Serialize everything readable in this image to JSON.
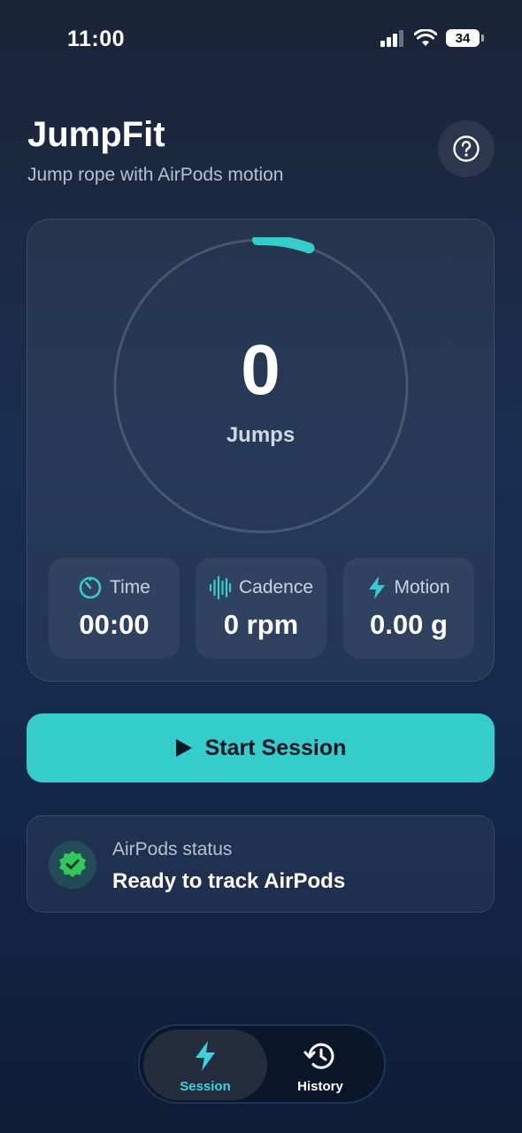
{
  "status_bar": {
    "time": "11:00",
    "battery": "34",
    "icons": [
      "cellular-signal-icon",
      "wifi-icon",
      "battery-icon"
    ]
  },
  "header": {
    "title": "JumpFit",
    "subtitle": "Jump rope with AirPods motion",
    "help_icon": "question-mark-icon"
  },
  "counter": {
    "value": "0",
    "label": "Jumps"
  },
  "stats": [
    {
      "label": "Time",
      "value": "00:00",
      "icon": "timer-icon"
    },
    {
      "label": "Cadence",
      "value": "0 rpm",
      "icon": "waveform-icon"
    },
    {
      "label": "Motion",
      "value": "0.00 g",
      "icon": "bolt-icon"
    }
  ],
  "start_button": {
    "label": "Start Session",
    "icon": "play-icon"
  },
  "airpods_status": {
    "label": "AirPods status",
    "message": "Ready to track AirPods",
    "icon": "checkmark-seal-icon"
  },
  "tabs": [
    {
      "label": "Session",
      "icon": "bolt-icon",
      "selected": true
    },
    {
      "label": "History",
      "icon": "history-clock-icon",
      "selected": false
    }
  ],
  "colors": {
    "accent": "#35cccc",
    "background_top": "#1a2438",
    "background_bottom": "#0e1d36",
    "success": "#34c759"
  }
}
